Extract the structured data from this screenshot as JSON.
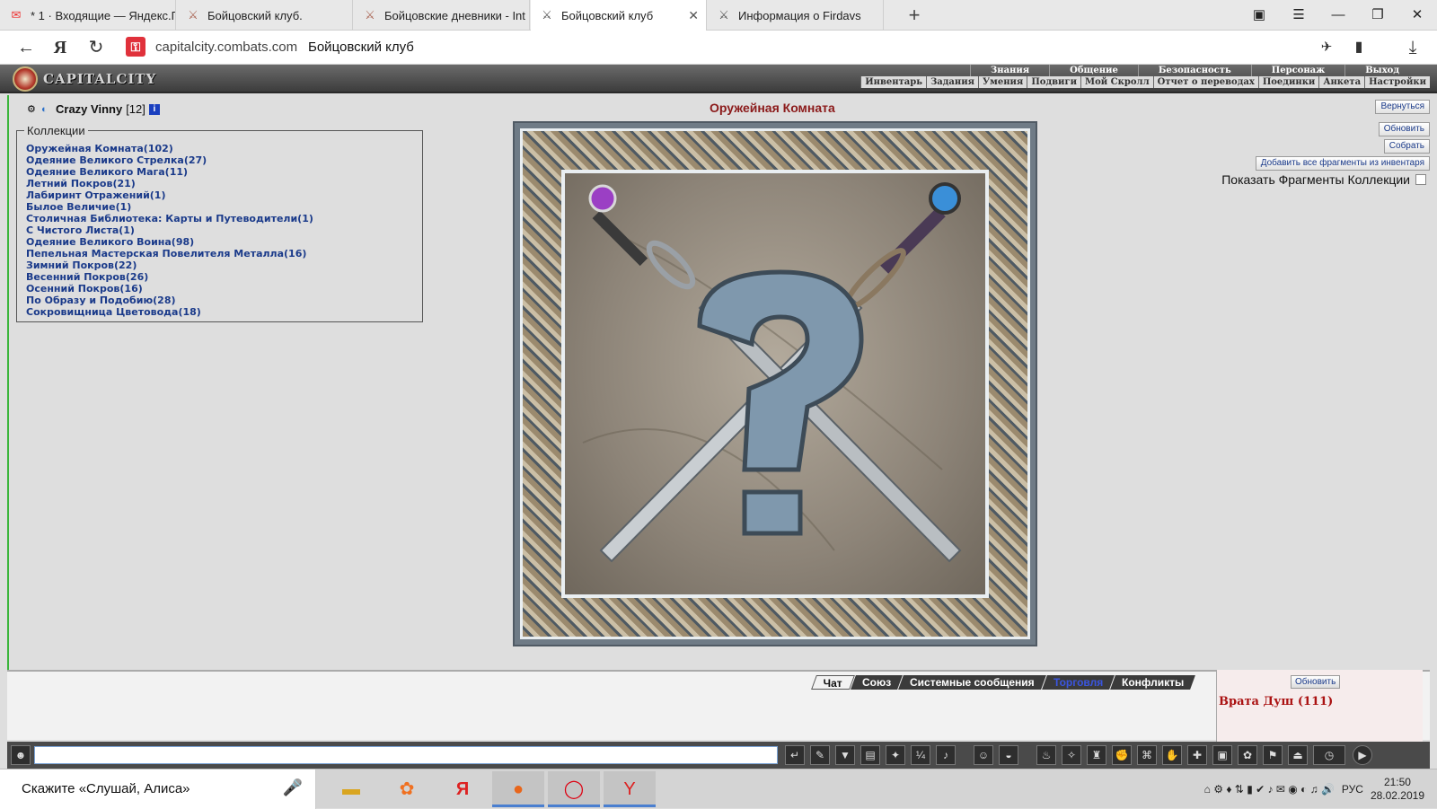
{
  "browser": {
    "tabs": [
      {
        "label": "* 1 · Входящие — Яндекс.П",
        "icon": "mail-icon"
      },
      {
        "label": "Бойцовский клуб.",
        "icon": "club-icon"
      },
      {
        "label": "Бойцовские дневники - Int",
        "icon": "club-icon"
      },
      {
        "label": "Бойцовский клуб",
        "icon": "swords-icon",
        "active": true
      },
      {
        "label": "Информация о Firdavs",
        "icon": "swords-icon"
      }
    ],
    "new_tab_symbol": "+",
    "url": "capitalcity.combats.com",
    "page_title": "Бойцовский клуб",
    "yandex_symbol": "Я"
  },
  "game": {
    "logo_text": "CAPITALCITY",
    "menu_top": [
      "Знания",
      "Общение",
      "Безопасность",
      "Персонаж",
      "Выход"
    ],
    "menu_sub": [
      "Инвентарь",
      "Задания",
      "Умения",
      "Подвиги",
      "Мой Скролл",
      "Отчет о переводах",
      "Поединки",
      "Анкета",
      "Настройки"
    ],
    "user": {
      "name": "Crazy Vinny",
      "level": "[12]",
      "info_symbol": "i"
    },
    "collections_legend": "Коллекции",
    "collections": [
      "Оружейная Комната(102)",
      "Одеяние Великого Стрелка(27)",
      "Одеяние Великого Мага(11)",
      "Летний Покров(21)",
      "Лабиринт Отражений(1)",
      "Былое Величие(1)",
      "Столичная Библиотека: Карты и Путеводители(1)",
      "С Чистого Листа(1)",
      "Одеяние Великого Воина(98)",
      "Пепельная Мастерская Повелителя Металла(16)",
      "Зимний Покров(22)",
      "Весенний Покров(26)",
      "Осенний Покров(16)",
      "По Образу и Подобию(28)",
      "Сокровищница Цветовода(18)"
    ],
    "room_title": "Оружейная Комната",
    "buttons": {
      "back": "Вернуться",
      "refresh": "Обновить",
      "collect": "Собрать",
      "add_all": "Добавить все фрагменты из инвентаря"
    },
    "show_fragments_label": "Показать Фрагменты Коллекции"
  },
  "chat": {
    "tabs": [
      "Чат",
      "Союз",
      "Системные сообщения",
      "Торговля",
      "Конфликты"
    ],
    "active_tab": "Чат",
    "refresh": "Обновить",
    "room_name": "Врата Душ (111)"
  },
  "taskbar": {
    "alice_prompt": "Скажите «Слушай, Алиса»",
    "lang": "РУС",
    "time": "21:50",
    "date": "28.02.2019"
  },
  "colors": {
    "room_title": "#8b1a1a",
    "collection_link": "#1a3a8a",
    "trade_tab": "#3a55e0",
    "room_name": "#aa1111"
  }
}
